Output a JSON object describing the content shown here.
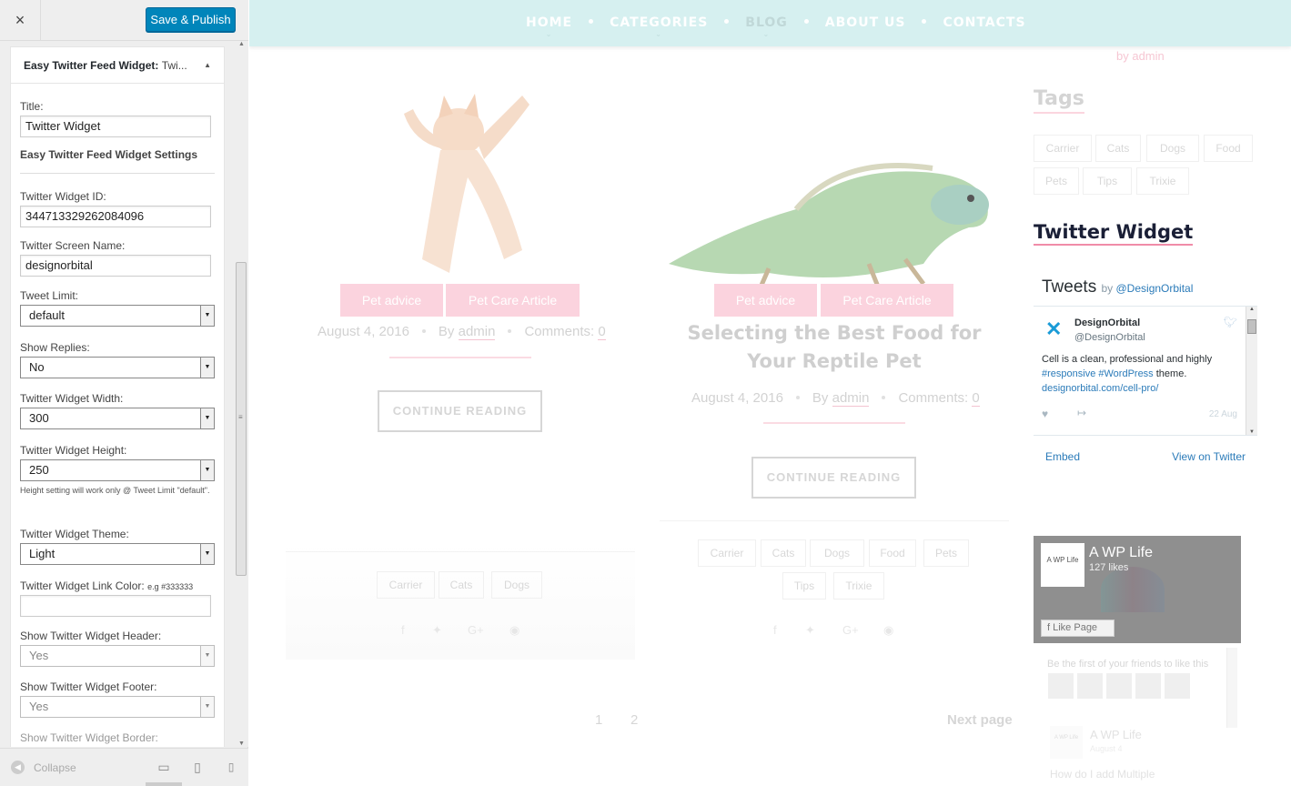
{
  "sidebar": {
    "close_icon": "×",
    "save_label": "Save & Publish",
    "widget_title_main": "Easy Twitter Feed Widget: ",
    "widget_title_sub": "Twi...",
    "fields": {
      "title_label": "Title:",
      "title_value": "Twitter Widget",
      "settings_heading": "Easy Twitter Feed Widget Settings",
      "widget_id_label": "Twitter Widget ID:",
      "widget_id_value": "344713329262084096",
      "screen_name_label": "Twitter Screen Name:",
      "screen_name_value": "designorbital",
      "tweet_limit_label": "Tweet Limit:",
      "tweet_limit_value": "default",
      "show_replies_label": "Show Replies:",
      "show_replies_value": "No",
      "width_label": "Twitter Widget Width:",
      "width_value": "300",
      "height_label": "Twitter Widget Height:",
      "height_value": "250",
      "height_help": "Height setting will work only @ Tweet Limit \"default\".",
      "theme_label": "Twitter Widget Theme:",
      "theme_value": "Light",
      "link_color_label": "Twitter Widget Link Color:",
      "link_color_hint": "e.g #333333",
      "link_color_value": "",
      "header_label": "Show Twitter Widget Header:",
      "header_value": "Yes",
      "footer_label": "Show Twitter Widget Footer:",
      "footer_value": "Yes",
      "border_label": "Show Twitter Widget Border:"
    },
    "collapse_label": "Collapse"
  },
  "nav": {
    "items": [
      "HOME",
      "CATEGORIES",
      "BLOG",
      "ABOUT US",
      "CONTACTS"
    ]
  },
  "preview": {
    "by_admin": "by admin",
    "posts": [
      {
        "badges": [
          "Pet advice",
          "Pet Care Article"
        ],
        "date": "August 4, 2016",
        "by": "By ",
        "author": "admin",
        "comments": "Comments: ",
        "comments_count": "0",
        "button": "CONTINUE READING",
        "tags": [
          "Carrier",
          "Cats",
          "Dogs"
        ]
      },
      {
        "badges": [
          "Pet advice",
          "Pet Care Article"
        ],
        "title_line1": "Selecting the Best Food for",
        "title_line2": "Your Reptile Pet",
        "date": "August 4, 2016",
        "by": "By ",
        "author": "admin",
        "comments": "Comments: ",
        "comments_count": "0",
        "button": "CONTINUE READING",
        "tags": [
          "Carrier",
          "Cats",
          "Dogs",
          "Food",
          "Pets",
          "Tips",
          "Trixie"
        ]
      }
    ],
    "pagination": {
      "p1": "1",
      "p2": "2",
      "next": "Next page"
    },
    "tags_title": "Tags",
    "sidebar_tags": [
      "Carrier",
      "Cats",
      "Dogs",
      "Food",
      "Pets",
      "Tips",
      "Trixie"
    ],
    "twitter": {
      "widget_title": "Twitter Widget",
      "header": "Tweets",
      "by": "by ",
      "by_handle": "@DesignOrbital",
      "name": "DesignOrbital",
      "handle": "@DesignOrbital",
      "text_plain": "Cell is a clean, professional and highly",
      "text_tags": "#responsive #WordPress",
      "text_theme": " theme.",
      "text_link": "designorbital.com/cell-pro/",
      "date": "22 Aug",
      "embed": "Embed",
      "view": "View on Twitter"
    },
    "facebook": {
      "logo_text": "A WP Life",
      "name": "A WP Life",
      "likes": "127 likes",
      "like_button": "Like Page",
      "friends_text": "Be the first of your friends to like this",
      "post_name": "A WP Life",
      "post_date": "August 4",
      "howto": "How do I add Multiple"
    }
  },
  "colors": {
    "primary_button": "#0085ba",
    "nav_bg": "#d6f0f0",
    "accent_pink": "#f08ca8",
    "twitter_link": "#2b7bb9"
  },
  "icons": [
    "close-icon",
    "chevron-up-icon",
    "dropdown-arrow-icon",
    "collapse-icon",
    "desktop-icon",
    "tablet-icon",
    "mobile-icon",
    "twitter-bird-icon",
    "heart-icon",
    "share-icon",
    "facebook-icon"
  ]
}
